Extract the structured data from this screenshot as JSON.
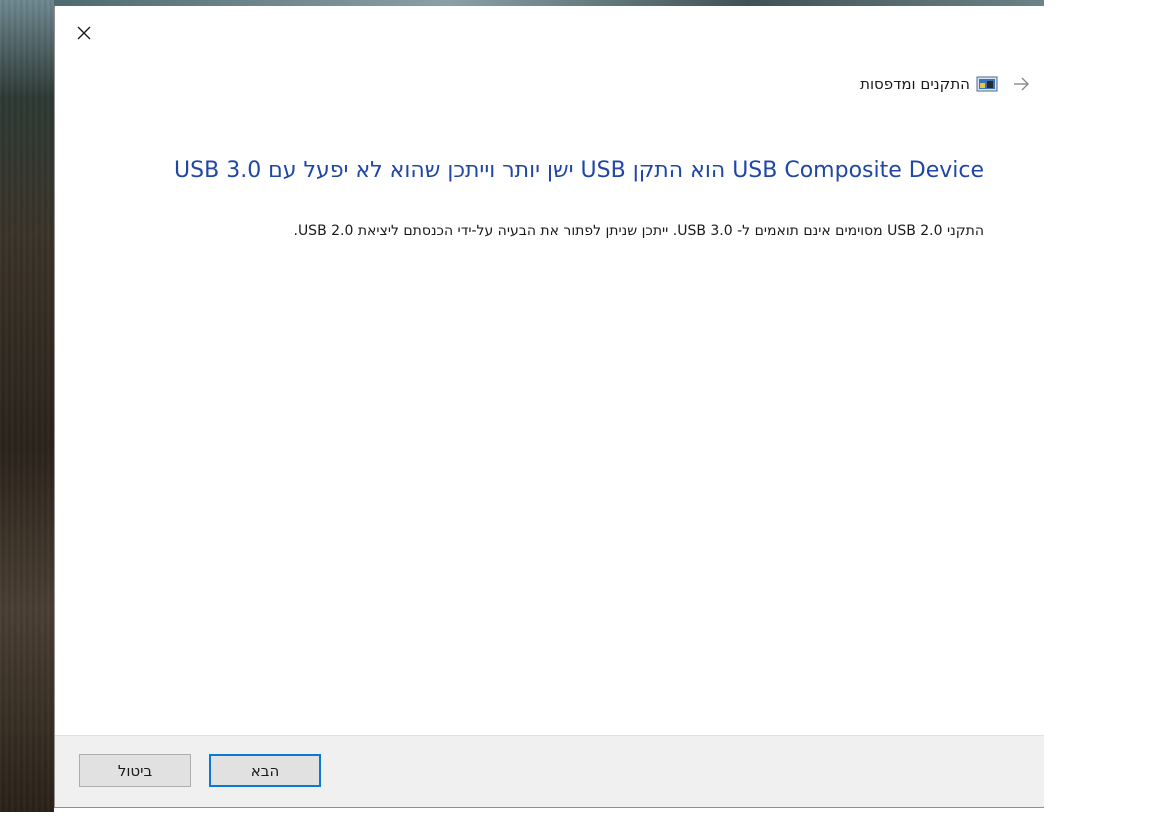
{
  "window": {
    "close_icon": "close-icon"
  },
  "breadcrumb": {
    "back_icon": "back-arrow-icon",
    "device_icon": "devices-printers-icon",
    "label": "התקנים ומדפסות"
  },
  "main": {
    "heading": "USB Composite Device הוא התקן USB ישן יותר וייתכן שהוא לא יפעל עם USB 3.0",
    "body": "התקני USB 2.0 מסוימים אינם תואמים ל- USB 3.0. ייתכן שניתן לפתור את הבעיה על-ידי הכנסתם ליציאת USB 2.0."
  },
  "footer": {
    "next_label": "הבא",
    "cancel_label": "ביטול"
  },
  "colors": {
    "heading": "#1f47a8",
    "focus_border": "#0a78d7",
    "footer_bg": "#f0f0f0"
  }
}
